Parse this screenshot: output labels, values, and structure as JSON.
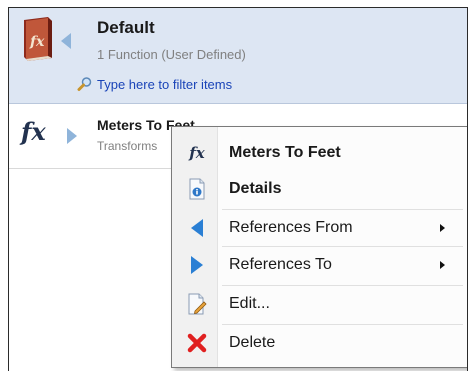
{
  "header": {
    "title": "Default",
    "subtitle": "1 Function (User Defined)",
    "filter_placeholder": "Type here to filter items"
  },
  "item": {
    "icon_glyph": "fx",
    "title": "Meters To Feet",
    "subtitle": "Transforms"
  },
  "context_menu": {
    "items": [
      {
        "label": "Meters To Feet",
        "icon": "fx-icon",
        "icon_glyph": "fx"
      },
      {
        "label": "Details",
        "icon": "details-icon"
      },
      {
        "label": "References From",
        "icon": "arrow-left-icon"
      },
      {
        "label": "References To",
        "icon": "arrow-right-icon"
      },
      {
        "label": "Edit...",
        "icon": "edit-icon"
      },
      {
        "label": "Delete",
        "icon": "delete-icon"
      }
    ]
  },
  "colors": {
    "header_bg": "#dde6f3",
    "filter_link": "#1a44b8",
    "arrow_blue": "#2a7fd4",
    "delete_red": "#e02020"
  }
}
